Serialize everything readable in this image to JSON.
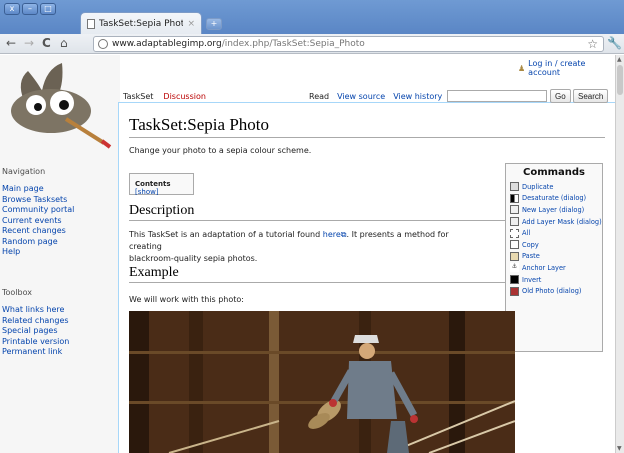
{
  "browser": {
    "window_buttons": [
      "x",
      "–",
      "□"
    ],
    "tab_title": "TaskSet:Sepia Photo - ...",
    "tab_close": "×",
    "new_tab": "+",
    "url_host": "www.adaptablegimp.org",
    "url_path": "/index.php/TaskSet:Sepia_Photo",
    "nav": {
      "back": "←",
      "forward": "→",
      "reload": "C",
      "home": "⌂"
    },
    "bookmark_icon": "star-icon",
    "menu_icon": "wrench-icon"
  },
  "header": {
    "login_link": "Log in / create account",
    "tabs": {
      "taskset": "TaskSet",
      "discussion": "Discussion"
    },
    "views": {
      "read": "Read",
      "view_source": "View source",
      "view_history": "View history"
    },
    "search": {
      "go": "Go",
      "search": "Search",
      "placeholder": ""
    }
  },
  "sidebar": {
    "navigation_heading": "Navigation",
    "navigation": [
      "Main page",
      "Browse Tasksets",
      "Community portal",
      "Current events",
      "Recent changes",
      "Random page",
      "Help"
    ],
    "toolbox_heading": "Toolbox",
    "toolbox": [
      "What links here",
      "Related changes",
      "Special pages",
      "Printable version",
      "Permanent link"
    ]
  },
  "article": {
    "title": "TaskSet:Sepia Photo",
    "intro": "Change your photo to a sepia colour scheme.",
    "toc_label": "Contents",
    "toc_toggle": "[show]",
    "description_heading": "Description",
    "description_before_link": "This TaskSet is an adaptation of a tutorial found ",
    "description_link": "here",
    "description_after_link": ". It presents a method for creating",
    "description_line2": "blackroom-quality sepia photos.",
    "example_heading": "Example",
    "example_text": "We will work with this photo:"
  },
  "commands": {
    "title": "Commands",
    "items": [
      "Duplicate",
      "Desaturate (dialog)",
      "New Layer (dialog)",
      "Add Layer Mask (dialog)",
      "All",
      "Copy",
      "Paste",
      "Anchor Layer",
      "Invert",
      "Old Photo (dialog)"
    ]
  },
  "colors": {
    "link": "#0645ad",
    "new_link": "#ba0000",
    "chrome": "#5a86c5"
  }
}
